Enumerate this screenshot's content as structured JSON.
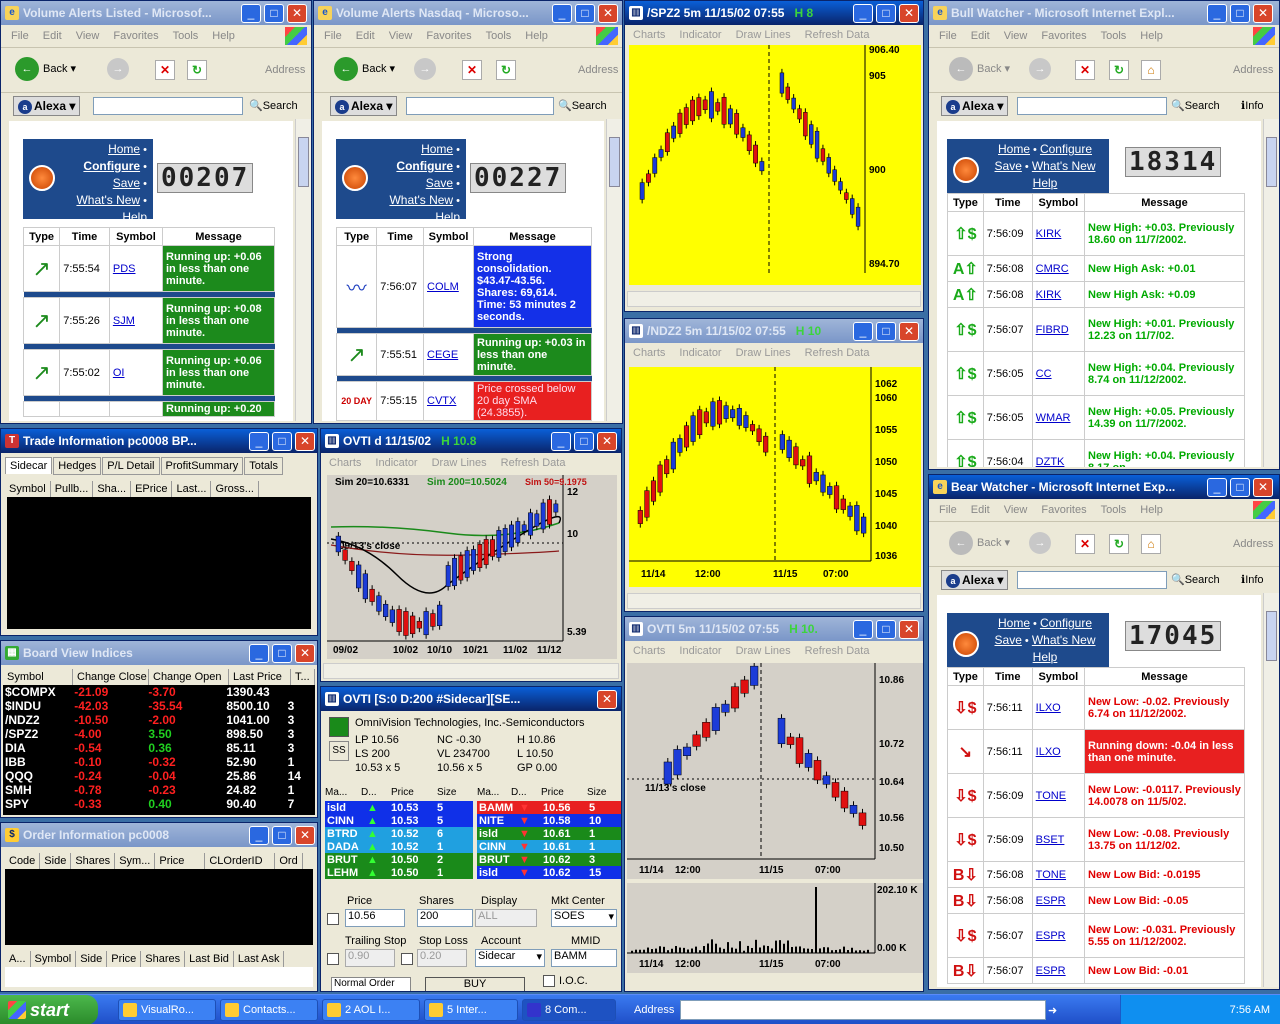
{
  "colors": {
    "yellow_chart": "#ffff00",
    "grey_chart": "#d4d0c8",
    "green_msg": "#1c8a1c",
    "blue_msg": "#1430e8",
    "red_msg": "#e82020"
  },
  "browser_menu": [
    "File",
    "Edit",
    "View",
    "Favorites",
    "Tools",
    "Help"
  ],
  "nav": {
    "back": "Back",
    "address": "Address",
    "search": "Search",
    "alexa": "Alexa",
    "info": "Info"
  },
  "portal_links": {
    "home": "Home",
    "configure": "Configure",
    "save": "Save",
    "whats_new": "What's New",
    "help": "Help"
  },
  "alert_headers": {
    "type": "Type",
    "time": "Time",
    "symbol": "Symbol",
    "message": "Message"
  },
  "vol_listed": {
    "title": "Volume Alerts Listed - Microsof...",
    "counter": "00207",
    "rows": [
      {
        "time": "7:55:54",
        "symbol": "PDS",
        "message": "Running up: +0.06 in less than one minute.",
        "style": "g",
        "icon": "↗"
      },
      {
        "time": "7:55:26",
        "symbol": "SJM",
        "message": "Running up: +0.08 in less than one minute.",
        "style": "g",
        "icon": "↗"
      },
      {
        "time": "7:55:02",
        "symbol": "OI",
        "message": "Running up: +0.06 in less than one minute.",
        "style": "g",
        "icon": "↗"
      },
      {
        "time": "",
        "symbol": "",
        "message": "Running up: +0.20",
        "style": "g",
        "icon": ""
      }
    ]
  },
  "vol_nasdaq": {
    "title": "Volume Alerts Nasdaq - Microso...",
    "counter": "00227",
    "rows": [
      {
        "time": "7:56:07",
        "symbol": "COLM",
        "message": "Strong consolidation. $43.47-43.56. Shares: 69,614. Time: 53 minutes 2 seconds.",
        "style": "b",
        "icon": "〰"
      },
      {
        "time": "7:55:51",
        "symbol": "CEGE",
        "message": "Running up: +0.03 in less than one minute.",
        "style": "g",
        "icon": "↗"
      },
      {
        "time": "7:55:15",
        "symbol": "CVTX",
        "message": "Price crossed below 20 day SMA (24.3855).",
        "style": "r",
        "icon": "20 DAY"
      }
    ]
  },
  "bull": {
    "title": "Bull Watcher - Microsoft Internet Expl...",
    "counter": "18314",
    "rows": [
      {
        "icon": "⇧$",
        "time": "7:56:09",
        "symbol": "KIRK",
        "message": "New High: +0.03. Previously 18.60 on 11/7/2002."
      },
      {
        "icon": "A⇧",
        "time": "7:56:08",
        "symbol": "CMRC",
        "message": "New High Ask: +0.01"
      },
      {
        "icon": "A⇧",
        "time": "7:56:08",
        "symbol": "KIRK",
        "message": "New High Ask: +0.09"
      },
      {
        "icon": "⇧$",
        "time": "7:56:07",
        "symbol": "FIBRD",
        "message": "New High: +0.01. Previously 12.23 on 11/7/02."
      },
      {
        "icon": "⇧$",
        "time": "7:56:05",
        "symbol": "CC",
        "message": "New High: +0.04. Previously 8.74 on 11/12/2002."
      },
      {
        "icon": "⇧$",
        "time": "7:56:05",
        "symbol": "WMAR",
        "message": "New High: +0.05. Previously 14.39 on 11/7/2002."
      },
      {
        "icon": "⇧$",
        "time": "7:56:04",
        "symbol": "DZTK",
        "message": "New High: +0.04. Previously 8.17 on"
      }
    ]
  },
  "bear": {
    "title": "Bear Watcher - Microsoft Internet Exp...",
    "counter": "17045",
    "rows": [
      {
        "icon": "⇩$",
        "time": "7:56:11",
        "symbol": "ILXO",
        "message": "New Low: -0.02. Previously 6.74 on 11/12/2002.",
        "hl": false
      },
      {
        "icon": "↘",
        "time": "7:56:11",
        "symbol": "ILXO",
        "message": "Running down: -0.04 in less than one minute.",
        "hl": true
      },
      {
        "icon": "⇩$",
        "time": "7:56:09",
        "symbol": "TONE",
        "message": "New Low: -0.0117. Previously 14.0078 on 11/5/02.",
        "hl": false
      },
      {
        "icon": "⇩$",
        "time": "7:56:09",
        "symbol": "BSET",
        "message": "New Low: -0.08. Previously 13.75 on 11/12/02.",
        "hl": false
      },
      {
        "icon": "B⇩",
        "time": "7:56:08",
        "symbol": "TONE",
        "message": "New Low Bid: -0.0195",
        "hl": false
      },
      {
        "icon": "B⇩",
        "time": "7:56:08",
        "symbol": "ESPR",
        "message": "New Low Bid: -0.05",
        "hl": false
      },
      {
        "icon": "⇩$",
        "time": "7:56:07",
        "symbol": "ESPR",
        "message": "New Low: -0.031. Previously 5.55 on 11/12/2002.",
        "hl": false
      },
      {
        "icon": "B⇩",
        "time": "7:56:07",
        "symbol": "ESPR",
        "message": "New Low Bid: -0.01",
        "hl": false
      }
    ]
  },
  "chart_menu": [
    "Charts",
    "Indicator",
    "Draw Lines",
    "Refresh Data"
  ],
  "spz2": {
    "title": "/SPZ2 5m 11/15/02 07:55",
    "h": "H 8",
    "yticks": [
      "906.40",
      "905",
      "900",
      "894.70"
    ]
  },
  "ndz2": {
    "title": "/NDZ2 5m 11/15/02 07:55",
    "h": "H 10",
    "yticks": [
      "1062",
      "1060",
      "1055",
      "1050",
      "1045",
      "1040",
      "1036"
    ],
    "xticks": [
      "11/14",
      "12:00",
      "11/15",
      "07:00"
    ]
  },
  "ovti5": {
    "title": "OVTI 5m 11/15/02 07:55",
    "h": "H 10.",
    "yticks": [
      "10.86",
      "10.72",
      "10.64",
      "10.56",
      "10.50"
    ],
    "xticks": [
      "11/14",
      "12:00",
      "11/15",
      "07:00"
    ],
    "close_lbl": "11/13's close",
    "vol_ticks": [
      "202.10 K",
      "0.00 K"
    ]
  },
  "ovtid": {
    "title": "OVTI d 11/15/02",
    "h": "H 10.8",
    "sim20": "Sim 20=10.6331",
    "sim200": "Sim 200=10.5024",
    "sim50": "Sim 50=9.1975",
    "close_lbl": "09/13's close",
    "yticks": [
      "12",
      "10",
      "5.39"
    ],
    "xticks": [
      "09/02",
      "10/02",
      "10/10",
      "10/21",
      "11/02",
      "11/12"
    ]
  },
  "trade": {
    "title": "Trade Information  pc0008   BP...",
    "tabs": [
      "Sidecar",
      "Hedges",
      "P/L Detail",
      "ProfitSummary",
      "Totals"
    ],
    "cols": [
      "Symbol",
      "Pullb...",
      "Sha...",
      "EPrice",
      "Last...",
      "Gross..."
    ]
  },
  "board": {
    "title": "Board View  Indices",
    "cols": [
      "Symbol",
      "Change Close",
      "Change Open",
      "Last Price",
      "T..."
    ],
    "rows": [
      [
        "$COMPX",
        "-21.09",
        "-3.70",
        "1390.43",
        ""
      ],
      [
        "$INDU",
        "-42.03",
        "-35.54",
        "8500.10",
        "3"
      ],
      [
        "/NDZ2",
        "-10.50",
        "-2.00",
        "1041.00",
        "3"
      ],
      [
        "/SPZ2",
        "-4.00",
        "3.50",
        "898.50",
        "3"
      ],
      [
        "DIA",
        "-0.54",
        "0.36",
        "85.11",
        "3"
      ],
      [
        "IBB",
        "-0.10",
        "-0.32",
        "52.90",
        "1"
      ],
      [
        "QQQ",
        "-0.24",
        "-0.04",
        "25.86",
        "14"
      ],
      [
        "SMH",
        "-0.78",
        "-0.23",
        "24.82",
        "1"
      ],
      [
        "SPY",
        "-0.33",
        "0.40",
        "90.40",
        "7"
      ]
    ]
  },
  "order": {
    "title": "Order Information  pc0008",
    "cols": [
      "Code",
      "Side",
      "Shares",
      "Sym...",
      "Price",
      "CLOrderID",
      "Ord"
    ],
    "cols2": [
      "A...",
      "Symbol",
      "Side",
      "Price",
      "Shares",
      "Last Bid",
      "Last Ask"
    ]
  },
  "sidecar": {
    "title": "OVTI [S:0 D:200 #Sidecar][SE...",
    "company": "OmniVision Technologies, Inc.-Semiconductors",
    "lp": "LP 10.56",
    "nc": "NC -0.30",
    "h": "H 10.86",
    "ls": "LS 200",
    "vl": "VL 234700",
    "l": "L 10.50",
    "bid": "10.53 x 5",
    "ask": "10.56 x 5",
    "gp": "GP 0.00",
    "ss": "SS",
    "bidhdr": [
      "Ma...",
      "D...",
      "Price",
      "Size"
    ],
    "bids": [
      [
        "isld",
        "10.53",
        "5"
      ],
      [
        "CINN",
        "10.53",
        "5"
      ],
      [
        "BTRD",
        "10.52",
        "6"
      ],
      [
        "DADA",
        "10.52",
        "1"
      ],
      [
        "BRUT",
        "10.50",
        "2"
      ],
      [
        "LEHM",
        "10.50",
        "1"
      ]
    ],
    "asks": [
      [
        "BAMM",
        "10.56",
        "5"
      ],
      [
        "NITE",
        "10.58",
        "10"
      ],
      [
        "isld",
        "10.61",
        "1"
      ],
      [
        "CINN",
        "10.61",
        "1"
      ],
      [
        "BRUT",
        "10.62",
        "3"
      ],
      [
        "isld",
        "10.62",
        "15"
      ]
    ],
    "price_lbl": "Price",
    "shares_lbl": "Shares",
    "display_lbl": "Display",
    "mkt_lbl": "Mkt Center",
    "price": "10.56",
    "shares": "200",
    "display": "ALL",
    "mkt": "SOES",
    "trail_lbl": "Trailing Stop",
    "stop_lbl": "Stop Loss",
    "acct_lbl": "Account",
    "mmid_lbl": "MMID",
    "trail": "0.90",
    "stop": "0.20",
    "acct": "Sidecar",
    "mmid": "BAMM",
    "ioc": "I.O.C.",
    "normal": "Normal Order",
    "buy": "BUY"
  },
  "taskbar": {
    "start": "start",
    "tasks": [
      "VisualRo...",
      "Contacts...",
      "2 AOL I...",
      "5 Inter...",
      "8 Com..."
    ],
    "address": "Address",
    "go": "Go",
    "clock": "7:56 AM"
  }
}
